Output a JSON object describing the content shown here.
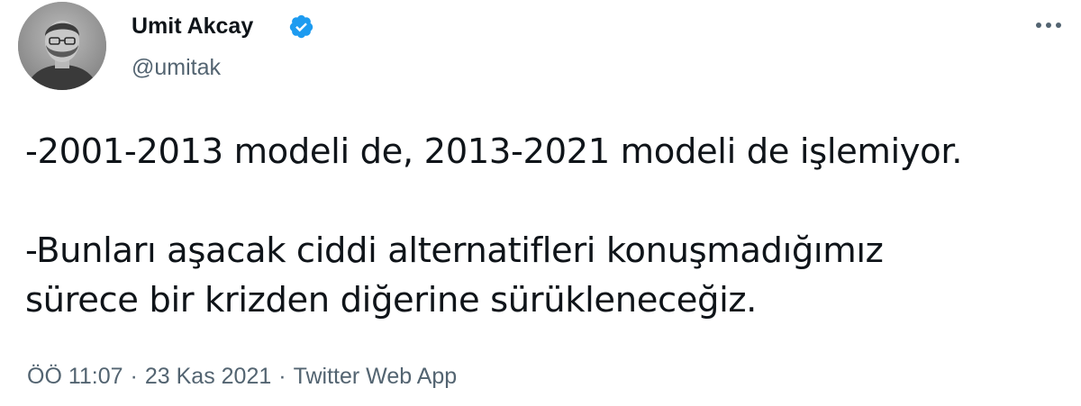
{
  "author": {
    "display_name": "Umit Akcay",
    "handle": "@umitak",
    "verified": true,
    "verified_color": "#1d9bf0"
  },
  "menu": {
    "more_icon": "more-horizontal-icon"
  },
  "tweet": {
    "paragraphs": [
      "-2001-2013 modeli de, 2013-2021 modeli de işlemiyor.",
      "-Bunları aşacak ciddi alternatifleri konuşmadığımız\nsürece bir krizden diğerine sürükleneceğiz."
    ]
  },
  "meta": {
    "time": "ÖÖ 11:07",
    "date": "23 Kas 2021",
    "source": "Twitter Web App",
    "separator": "·"
  }
}
